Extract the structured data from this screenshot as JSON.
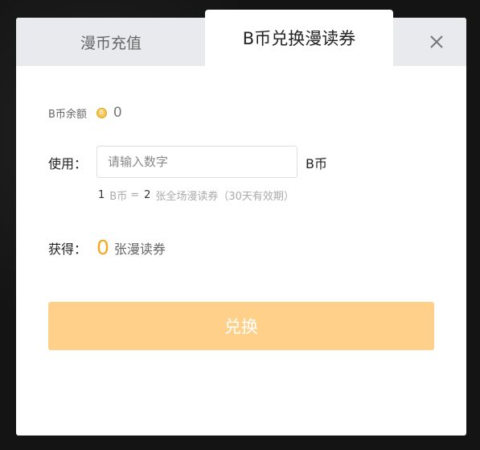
{
  "tabs": {
    "recharge": "漫币充值",
    "exchange": "B币兑换漫读券"
  },
  "balance": {
    "label": "B币余额",
    "coin_icon": "b-coin-icon",
    "value": "0"
  },
  "use": {
    "label": "使用：",
    "placeholder": "请输入数字",
    "value": "",
    "unit": "B币"
  },
  "rate": {
    "left_num": "1",
    "left_unit": "B币",
    "equals": "=",
    "right_num": "2",
    "right_text": "张全场漫读券（30天有效期）"
  },
  "get": {
    "label": "获得：",
    "count": "0",
    "unit": "张漫读券"
  },
  "button": {
    "label": "兑换"
  },
  "colors": {
    "accent": "#f5a623",
    "button_disabled": "#ffd08a",
    "tab_bar": "#e9eaee"
  }
}
